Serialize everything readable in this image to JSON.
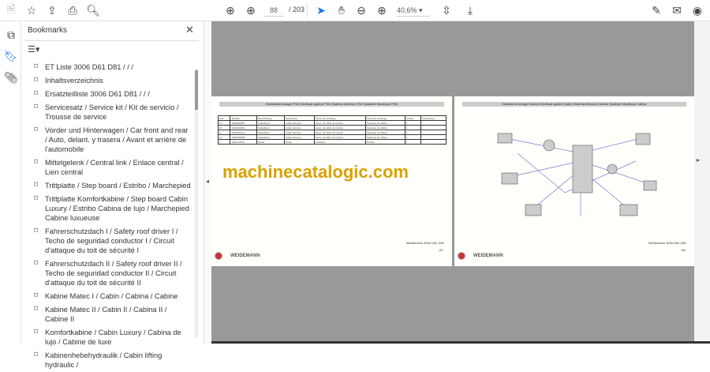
{
  "toolbar": {
    "page_current": "88",
    "page_total": "/ 203",
    "zoom": "40,6%"
  },
  "bookmarks": {
    "title": "Bookmarks",
    "close": "✕",
    "items": [
      "ET Liste 3006 D61 D81 /  /  /",
      "Inhaltsverzeichnis",
      "Ersatzteilliste 3006 D61 D81 /  /  /",
      "Servicesatz / Service kit / Kit de servicio / Trousse de service",
      "Vorder und Hinterwagen / Car front and rear / Auto, delant. y trasera / Avant et arrière de l'automobile",
      "Mittelgelenk / Central link / Enlace central / Lien central",
      "Trittplatte / Step board / Estribo / Marchepied",
      "Trittplatte Komfortkabine / Step board Cabin Luxury / Estribo Cabina de lujo / Marchepied Cabine luxueuse",
      "Fahrerschutzdach I / Safety roof driver I / Techo de seguridad conductor I / Circuit d'attaque du toit de sécurité I",
      "Fahrerschutzdach II / Safety roof driver II / Techo de seguridad conductor II / Circuit d'attaque du toit de sécurité II",
      "Kabine Matec I / Cabin / Cabina / Cabine",
      "Kabine Matec II / Cabin II / Cabina II / Cabine II",
      "Komfortkabine / Cabin Luxury / Cabina de lujo / Cabine de luxe",
      "Kabinenhebehydraulik / Cabin lifting hydraulic /"
    ]
  },
  "pages": {
    "left": {
      "title": "Elektrische Anlage FSD Electrical system FSD Sistema eléctrico FSD Système électrique FSD",
      "footer": "Weidemann 3006 D61 D81",
      "number": "-87-",
      "brand": "WEIDEMANN",
      "headers": [
        "Pos.",
        "Artikel#",
        "Bezeichnung",
        "Description",
        "Pièce de rechange",
        "Pièce de rechange",
        "Anzahl",
        "Ausführung"
      ],
      "rows": [
        [
          "1a",
          "1000186087",
          "Kabelbaum",
          "Cable harness",
          "Ensp. de câble de traction",
          "Faisceau de câbles",
          "1",
          ""
        ],
        [
          "1b",
          "1000201003",
          "Kabelbaum",
          "Cable harness",
          "Ensp. de câble de traction",
          "Faisceau de câbles",
          "1",
          ""
        ],
        [
          "1c",
          "1000202441",
          "Kabelbaum",
          "Cable harness",
          "Ensp. de câble de traction",
          "Faisceau de câbles",
          "1",
          ""
        ],
        [
          "1d",
          "1000186088",
          "Kabelbaum",
          "Cable harness",
          "Ensp. de câble de traction",
          "Faisceau de câbles",
          "1",
          ""
        ],
        [
          "2",
          "1000113794",
          "Diode",
          "Diode",
          "Varistans",
          "Perdiet",
          "1",
          ""
        ]
      ]
    },
    "right": {
      "title": "Elektrische Anlage Kabine Electrical system Cabin Sistema eléctrico Cabina Système électrique Cabine",
      "footer": "Weidemann 3006 D61 D81",
      "number": "-88-",
      "brand": "WEIDEMANN"
    }
  },
  "watermark": "machinecatalogic.com"
}
